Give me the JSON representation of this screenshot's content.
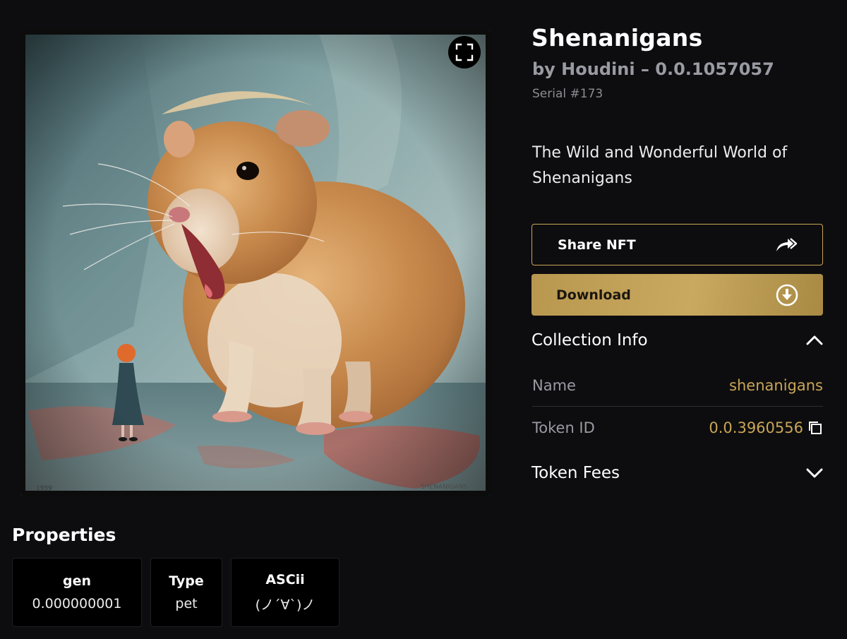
{
  "nft": {
    "title": "Shenanigans",
    "byline": "by Houdini – 0.0.1057057",
    "serial": "Serial #173",
    "description": "The Wild and Wonderful World of Shenanigans",
    "artwork": {
      "signature_left": "1959",
      "signature_right": "SHENANIGANS"
    }
  },
  "actions": {
    "share_label": "Share NFT",
    "download_label": "Download"
  },
  "collection_info": {
    "heading": "Collection Info",
    "expanded": true,
    "rows": [
      {
        "label": "Name",
        "value": "shenanigans"
      },
      {
        "label": "Token ID",
        "value": "0.0.3960556"
      }
    ]
  },
  "token_fees": {
    "heading": "Token Fees",
    "expanded": false
  },
  "properties": {
    "heading": "Properties",
    "items": [
      {
        "key": "gen",
        "value": "0.000000001"
      },
      {
        "key": "Type",
        "value": "pet"
      },
      {
        "key": "ASCii",
        "value": "(ノ´∀`)ノ"
      }
    ]
  },
  "colors": {
    "background": "#0d0d0f",
    "accent_gold": "#c9a557",
    "muted_text": "#9a9aa3"
  },
  "icons": [
    "expand-icon",
    "share-arrow-icon",
    "download-circle-icon",
    "chevron-up-icon",
    "chevron-down-icon",
    "copy-icon"
  ]
}
